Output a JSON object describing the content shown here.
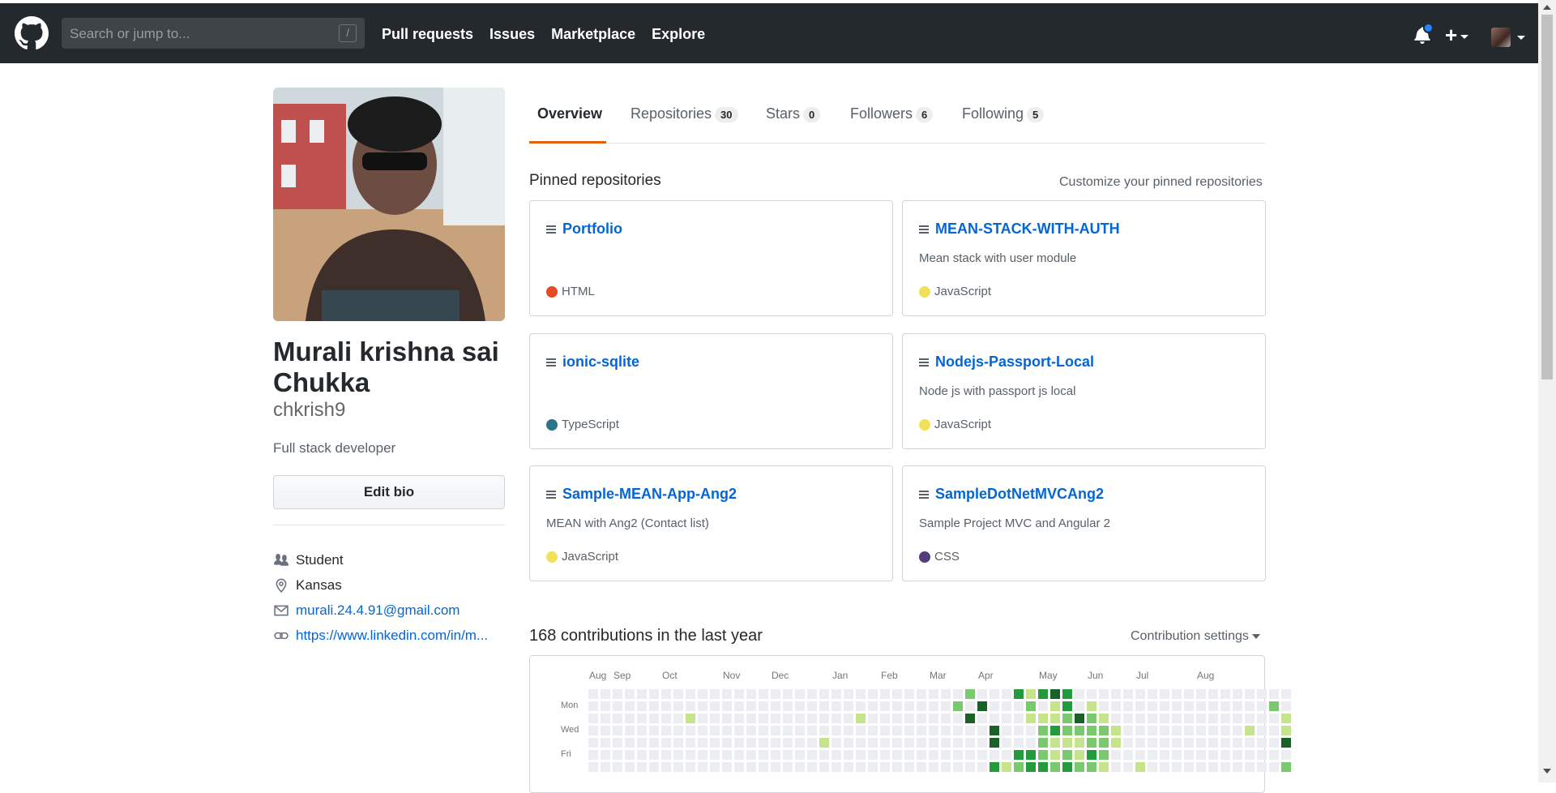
{
  "header": {
    "search_placeholder": "Search or jump to...",
    "search_shortcut": "/",
    "nav": [
      "Pull requests",
      "Issues",
      "Marketplace",
      "Explore"
    ],
    "plus_label": "+"
  },
  "profile": {
    "full_name": "Murali krishna sai Chukka",
    "username": "chkrish9",
    "bio": "Full stack developer",
    "edit_bio_label": "Edit bio",
    "vcard": {
      "organization": "Student",
      "location": "Kansas",
      "email": "murali.24.4.91@gmail.com",
      "website": "https://www.linkedin.com/in/m..."
    }
  },
  "tabs": [
    {
      "label": "Overview",
      "count": ""
    },
    {
      "label": "Repositories",
      "count": "30"
    },
    {
      "label": "Stars",
      "count": "0"
    },
    {
      "label": "Followers",
      "count": "6"
    },
    {
      "label": "Following",
      "count": "5"
    }
  ],
  "pinned": {
    "title": "Pinned repositories",
    "customize_label": "Customize your pinned repositories",
    "repos": [
      {
        "name": "Portfolio",
        "description": "",
        "language": "HTML",
        "lang_color": "#e34c26"
      },
      {
        "name": "MEAN-STACK-WITH-AUTH",
        "description": "Mean stack with user module",
        "language": "JavaScript",
        "lang_color": "#f1e05a"
      },
      {
        "name": "ionic-sqlite",
        "description": "",
        "language": "TypeScript",
        "lang_color": "#2b7489"
      },
      {
        "name": "Nodejs-Passport-Local",
        "description": "Node js with passport js local",
        "language": "JavaScript",
        "lang_color": "#f1e05a"
      },
      {
        "name": "Sample-MEAN-App-Ang2",
        "description": "MEAN with Ang2 (Contact list)",
        "language": "JavaScript",
        "lang_color": "#f1e05a"
      },
      {
        "name": "SampleDotNetMVCAng2",
        "description": "Sample Project MVC and Angular 2",
        "language": "CSS",
        "lang_color": "#563d7c"
      }
    ]
  },
  "contributions": {
    "title": "168 contributions in the last year",
    "settings_label": "Contribution settings",
    "months": [
      "Aug",
      "Sep",
      "Oct",
      "Nov",
      "Dec",
      "Jan",
      "Feb",
      "Mar",
      "Apr",
      "May",
      "Jun",
      "Jul",
      "Aug"
    ],
    "day_labels": [
      "Mon",
      "Wed",
      "Fri"
    ],
    "colors": [
      "#ebedf0",
      "#c6e48b",
      "#7bc96f",
      "#239a3b",
      "#196127"
    ],
    "levels": [
      "0000000000000000000000000000000200031343000000000000000000",
      "0000000000000000000000000000002040002013010000000000000020",
      "0000000010000000000000100000000400001112421000000000000001",
      "0000000000000000000000000000000004000232222100000000001001",
      "0000005000000000000100000000000004000211122100000000000004",
      "0000000000000000000000000000000000033212132000000000000000",
      "0000000000000000000000000000000003123323221001000000000002"
    ]
  },
  "colors": {
    "header_bg": "#24292e",
    "link": "#0366d6",
    "tab_accent": "#e36209",
    "notification_dot": "#2188ff"
  },
  "icons": [
    "github-mark-icon",
    "bell-icon",
    "plus-icon",
    "repo-icon",
    "people-icon",
    "location-icon",
    "mail-icon",
    "link-icon"
  ]
}
